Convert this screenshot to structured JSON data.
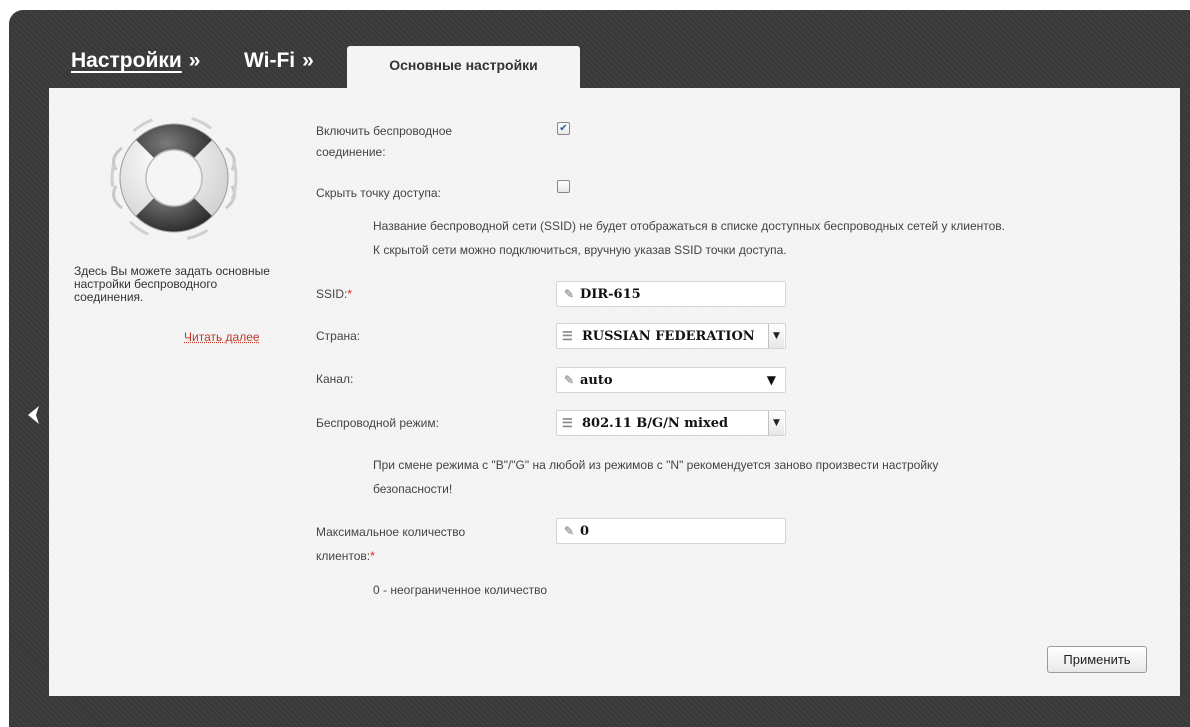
{
  "breadcrumb": {
    "settings": "Настройки",
    "wifi": "Wi-Fi",
    "separator": "»",
    "active_tab": "Основные настройки"
  },
  "sidebar": {
    "help_text": "Здесь Вы можете задать основные настройки беспроводного соединения.",
    "read_more": "Читать далее",
    "icon": "lifebuoy-icon"
  },
  "form": {
    "enable_wireless": {
      "label": "Включить беспроводное соединение:",
      "checked": true
    },
    "hide_ap": {
      "label": "Скрыть точку доступа:",
      "checked": false,
      "note_line1": "Название беспроводной сети (SSID) не будет отображаться в списке доступных беспроводных сетей у клиентов.",
      "note_line2": "К скрытой сети можно подключиться, вручную указав SSID точки доступа."
    },
    "ssid": {
      "label": "SSID:",
      "required": "*",
      "value": "DIR-615"
    },
    "country": {
      "label": "Страна:",
      "value": "RUSSIAN FEDERATION"
    },
    "channel": {
      "label": "Канал:",
      "value": "auto"
    },
    "mode": {
      "label": "Беспроводной режим:",
      "value": "802.11 B/G/N mixed",
      "note_line1": "При смене режима с \"B\"/\"G\" на любой из режимов с \"N\" рекомендуется заново произвести настройку",
      "note_line2": "безопасности!"
    },
    "max_clients": {
      "label_line1": "Максимальное количество",
      "label_line2": "клиентов:",
      "required": "*",
      "value": "0",
      "note": "0 - неограниченное количество"
    }
  },
  "apply_label": "Применить",
  "colors": {
    "frame": "#3a3a3a",
    "panel": "#f5f5f5",
    "required": "#e02020",
    "link": "#c0392b"
  }
}
